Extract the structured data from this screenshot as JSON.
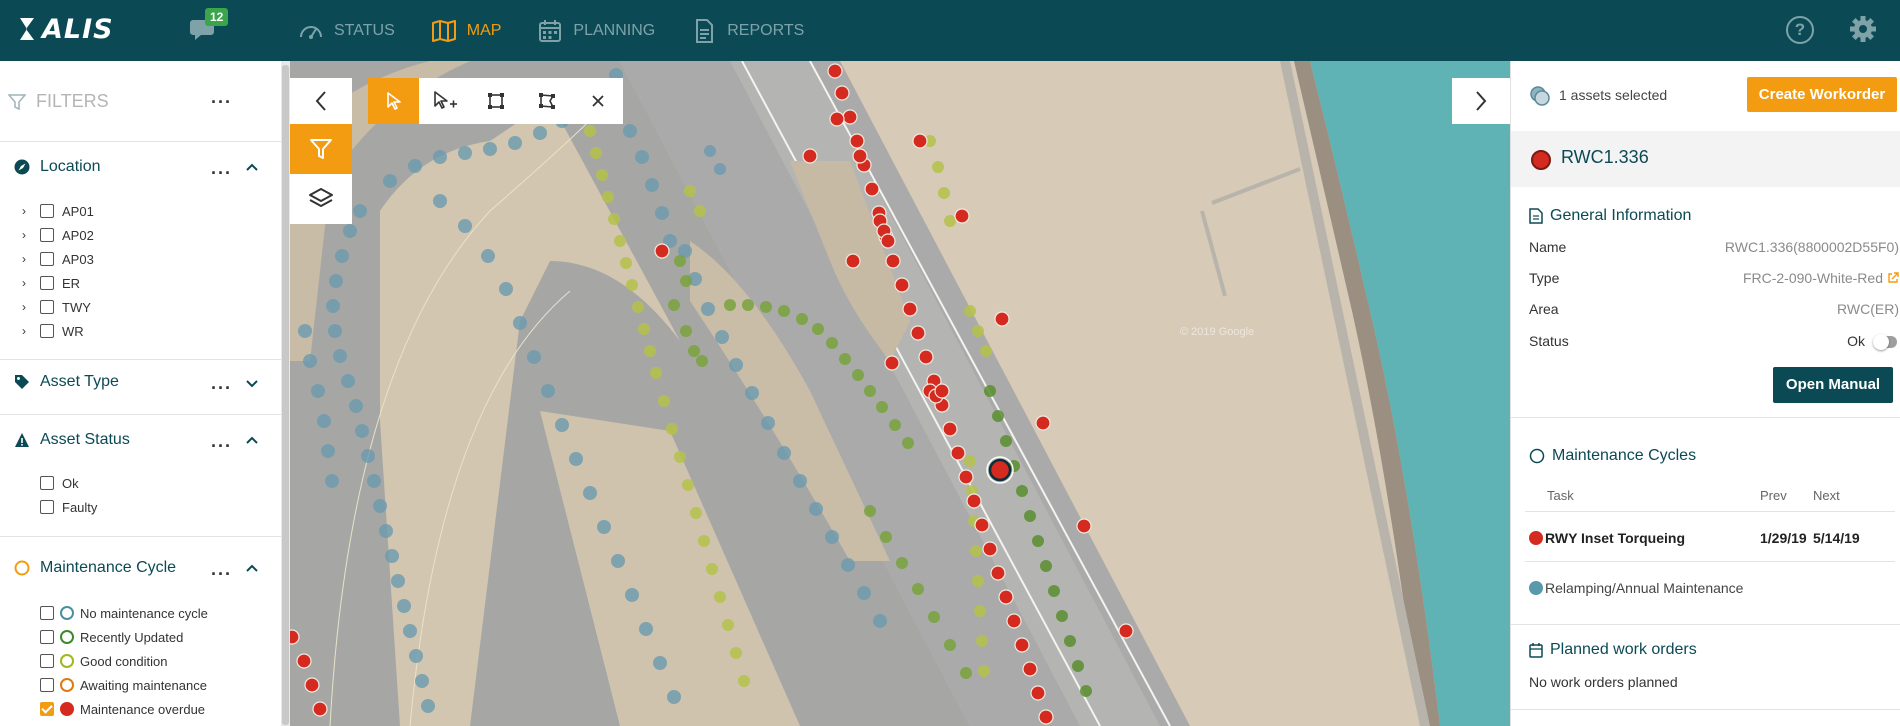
{
  "topbar": {
    "logo": "ALIS",
    "chat_count": "12",
    "nav": [
      {
        "label": "STATUS",
        "icon": "gauge-icon"
      },
      {
        "label": "MAP",
        "icon": "map-icon"
      },
      {
        "label": "PLANNING",
        "icon": "calendar-icon"
      },
      {
        "label": "REPORTS",
        "icon": "document-icon"
      }
    ],
    "help": "?",
    "accent": "#f39c12",
    "bar_color": "#0b4a55"
  },
  "filters": {
    "title": "FILTERS",
    "location": {
      "title": "Location",
      "items": [
        "AP01",
        "AP02",
        "AP03",
        "ER",
        "TWY",
        "WR"
      ]
    },
    "asset_type": {
      "title": "Asset Type"
    },
    "asset_status": {
      "title": "Asset Status",
      "items": [
        "Ok",
        "Faulty"
      ]
    },
    "maintenance_cycle": {
      "title": "Maintenance Cycle",
      "items": [
        {
          "label": "No maintenance cycle",
          "color": "#4a8fa0",
          "style": "ring",
          "checked": false
        },
        {
          "label": "Recently Updated",
          "color": "#3a8a2a",
          "style": "ring",
          "checked": false
        },
        {
          "label": "Good condition",
          "color": "#a0b818",
          "style": "ring",
          "checked": false
        },
        {
          "label": "Awaiting maintenance",
          "color": "#e07a10",
          "style": "ring",
          "checked": false
        },
        {
          "label": "Maintenance overdue",
          "color": "#d42a1f",
          "style": "dot",
          "checked": true
        }
      ]
    }
  },
  "map": {
    "watermark": "© 2019 Google"
  },
  "details": {
    "selected": "1 assets selected",
    "create_workorder": "Create Workorder",
    "asset_name": "RWC1.336",
    "general": {
      "title": "General Information",
      "rows": [
        {
          "key": "Name",
          "value": "RWC1.336(8800002D55F0)"
        },
        {
          "key": "Type",
          "value": "FRC-2-090-White-Red"
        },
        {
          "key": "Area",
          "value": "RWC(ER)"
        },
        {
          "key": "Status",
          "value": "Ok"
        }
      ]
    },
    "open_manual": "Open Manual",
    "maintenance": {
      "title": "Maintenance Cycles",
      "headers": {
        "task": "Task",
        "prev": "Prev",
        "next": "Next"
      },
      "tasks": [
        {
          "name": "RWY Inset Torqueing",
          "prev": "1/29/19",
          "next": "5/14/19",
          "color": "#d42a1f"
        },
        {
          "name": "Relamping/Annual Maintenance",
          "prev": "",
          "next": "",
          "color": "#5a98ab"
        }
      ]
    },
    "planned": {
      "title": "Planned work orders",
      "empty": "No work orders planned"
    }
  }
}
